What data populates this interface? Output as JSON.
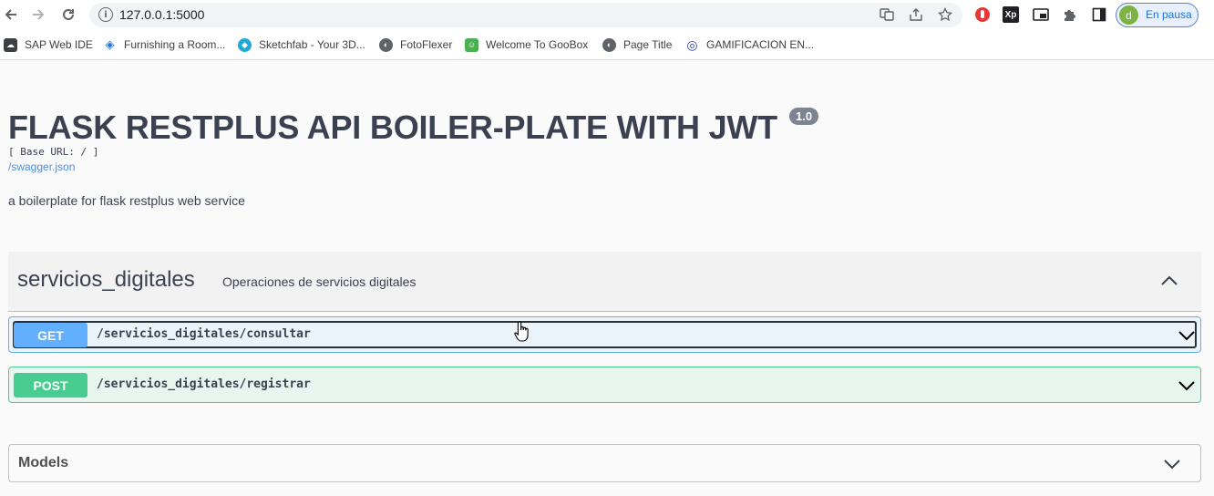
{
  "browser": {
    "url": "127.0.0.1:5000",
    "profile_label": "En pausa",
    "profile_initial": "d",
    "bookmarks": [
      {
        "label": "SAP Web IDE",
        "icon": "sap-icon",
        "color": "#3c4043"
      },
      {
        "label": "Furnishing a Room...",
        "icon": "cube-icon",
        "color": "#1a73e8"
      },
      {
        "label": "Sketchfab - Your 3D...",
        "icon": "sketchfab-icon",
        "color": "#1caad9"
      },
      {
        "label": "FotoFlexer",
        "icon": "globe-icon",
        "color": "#5f6368"
      },
      {
        "label": "Welcome To GooBox",
        "icon": "goobox-icon",
        "color": "#4caf50"
      },
      {
        "label": "Page Title",
        "icon": "globe-icon",
        "color": "#5f6368"
      },
      {
        "label": "GAMIFICACION EN...",
        "icon": "spiral-icon",
        "color": "#3949ab"
      }
    ],
    "extensions": [
      {
        "name": "adblock-icon",
        "glyph": "●",
        "color": "#e53935"
      },
      {
        "name": "xp-icon",
        "glyph": "Xp",
        "color": "#202124"
      },
      {
        "name": "pip-icon",
        "glyph": "▣",
        "color": "#202124"
      },
      {
        "name": "puzzle-icon",
        "glyph": "✱",
        "color": "#5f6368"
      },
      {
        "name": "sidepanel-icon",
        "glyph": "▥",
        "color": "#5f6368"
      }
    ]
  },
  "api": {
    "title": "FLASK RESTPLUS API BOILER-PLATE WITH JWT",
    "version": "1.0",
    "base_url": "[ Base URL: / ]",
    "spec_link": "/swagger.json",
    "description": "a boilerplate for flask restplus web service"
  },
  "tag": {
    "name": "servicios_digitales",
    "description": "Operaciones de servicios digitales",
    "expanded": true
  },
  "operations": [
    {
      "method": "GET",
      "path": "/servicios_digitales/consultar",
      "color": "#61affe"
    },
    {
      "method": "POST",
      "path": "/servicios_digitales/registrar",
      "color": "#49cc90"
    }
  ],
  "models": {
    "label": "Models"
  }
}
